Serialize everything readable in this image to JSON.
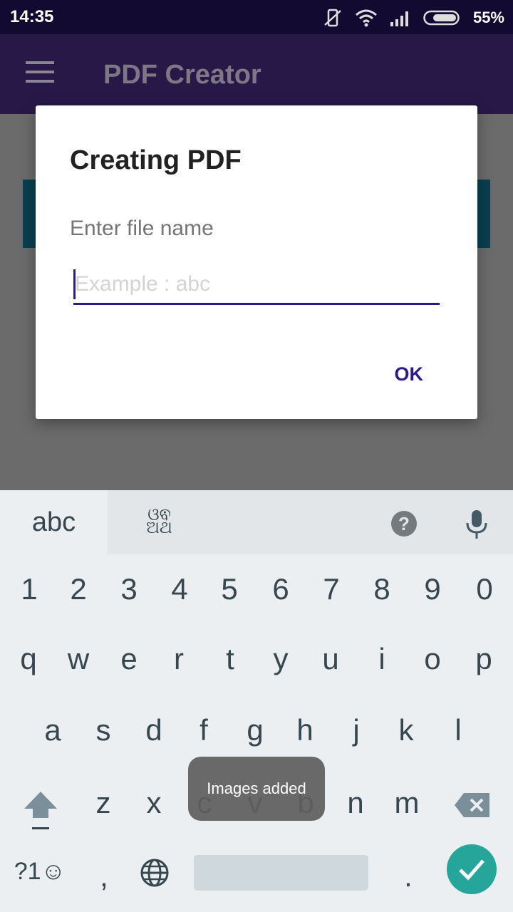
{
  "status_bar": {
    "time": "14:35",
    "battery": "55%"
  },
  "app_bar": {
    "title": "PDF Creator"
  },
  "dialog": {
    "title": "Creating PDF",
    "message": "Enter file name",
    "input": {
      "value": "",
      "placeholder": "Example : abc"
    },
    "ok_label": "OK"
  },
  "keyboard": {
    "tab_abc": "abc",
    "tab_lang": "ଓଵ\nଅଥ",
    "number_row": [
      "1",
      "2",
      "3",
      "4",
      "5",
      "6",
      "7",
      "8",
      "9",
      "0"
    ],
    "row1": [
      "q",
      "w",
      "e",
      "r",
      "t",
      "y",
      "u",
      "i",
      "o",
      "p"
    ],
    "row2": [
      "a",
      "s",
      "d",
      "f",
      "g",
      "h",
      "j",
      "k",
      "l"
    ],
    "row3": [
      "z",
      "x",
      "c",
      "v",
      "b",
      "n",
      "m"
    ],
    "symbols_label": "?1☺",
    "comma": ",",
    "period": "."
  },
  "toast": {
    "text": "Images added"
  },
  "colors": {
    "accent": "#2d1a8a",
    "app_bar": "#271848",
    "status_bar": "#120a30",
    "enter": "#26a69a"
  },
  "icons": [
    "menu-icon",
    "mute-icon",
    "wifi-icon",
    "signal-icon",
    "battery-icon",
    "help-icon",
    "mic-icon",
    "shift-icon",
    "backspace-icon",
    "globe-icon",
    "check-icon"
  ]
}
